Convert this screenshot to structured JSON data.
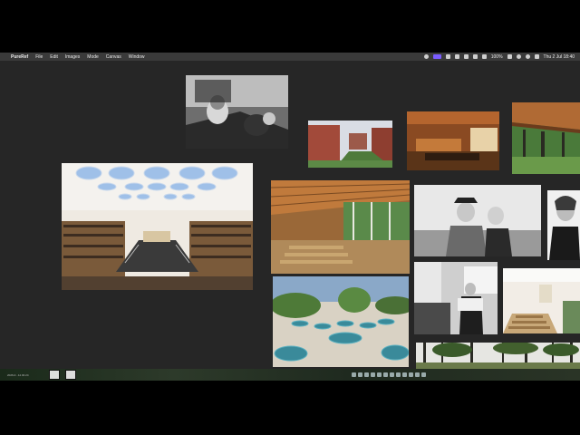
{
  "menubar": {
    "apple_glyph": "",
    "app_name": "PureRef",
    "menus": [
      "File",
      "Edit",
      "Images",
      "Mode",
      "Canvas",
      "Window"
    ],
    "battery": "100%",
    "datetime": "Thu 2 Jul  18:40"
  },
  "dock": {
    "left_label": "2026-0...12.00.24"
  },
  "icons": {
    "status": [
      "record-icon",
      "app-icon",
      "shield-icon",
      "drive-icon",
      "dropbox-icon",
      "messages-icon",
      "screen-icon",
      "battery-icon",
      "wifi-icon",
      "search-icon",
      "control-center-icon"
    ]
  }
}
